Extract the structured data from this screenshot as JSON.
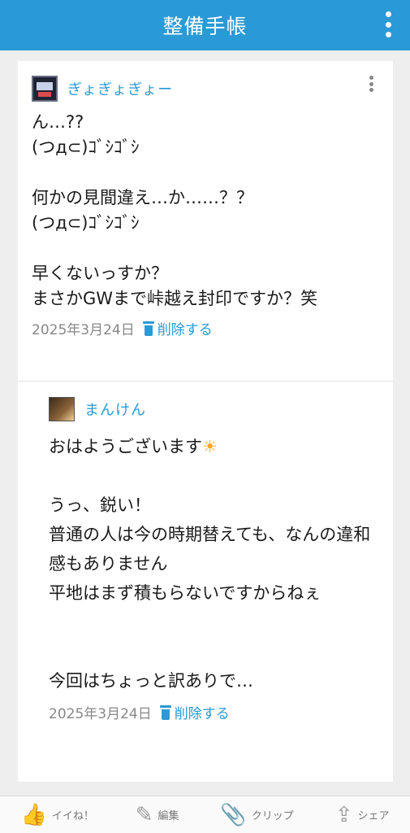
{
  "header": {
    "title": "整備手帳"
  },
  "post": {
    "username": "ぎょぎょぎょー",
    "body": "ん…??\n(つд⊂)ｺﾞｼｺﾞｼ\n\n何かの見間違え…か……？？\n(つд⊂)ｺﾞｼｺﾞｼ\n\n早くないっすか？\nまさかGWまで峠越え封印ですか？笑",
    "date": "2025年3月24日",
    "delete_label": "削除する"
  },
  "reply": {
    "username": "まんけん",
    "first_line": "おはようございます",
    "body": "\nうっ、鋭い！\n普通の人は今の時期替えても、なんの違和感もありません\n平地はまず積もらないですからねぇ\n\n\n今回はちょっと訳ありで…",
    "date": "2025年3月24日",
    "delete_label": "削除する"
  },
  "bottom_bar": {
    "like": "イイね！",
    "edit": "編集",
    "clip": "クリップ",
    "share": "シェア"
  },
  "icons": {
    "menu": "vertical-dots-icon",
    "like": "thumbs-up-icon",
    "edit": "pen-icon",
    "clip": "paperclip-icon",
    "share": "share-icon",
    "sun": "sun-emoji-icon",
    "trash": "trash-icon"
  },
  "colors": {
    "accent": "#2a9ad6",
    "meta": "#888888",
    "background": "#eeeeee"
  }
}
